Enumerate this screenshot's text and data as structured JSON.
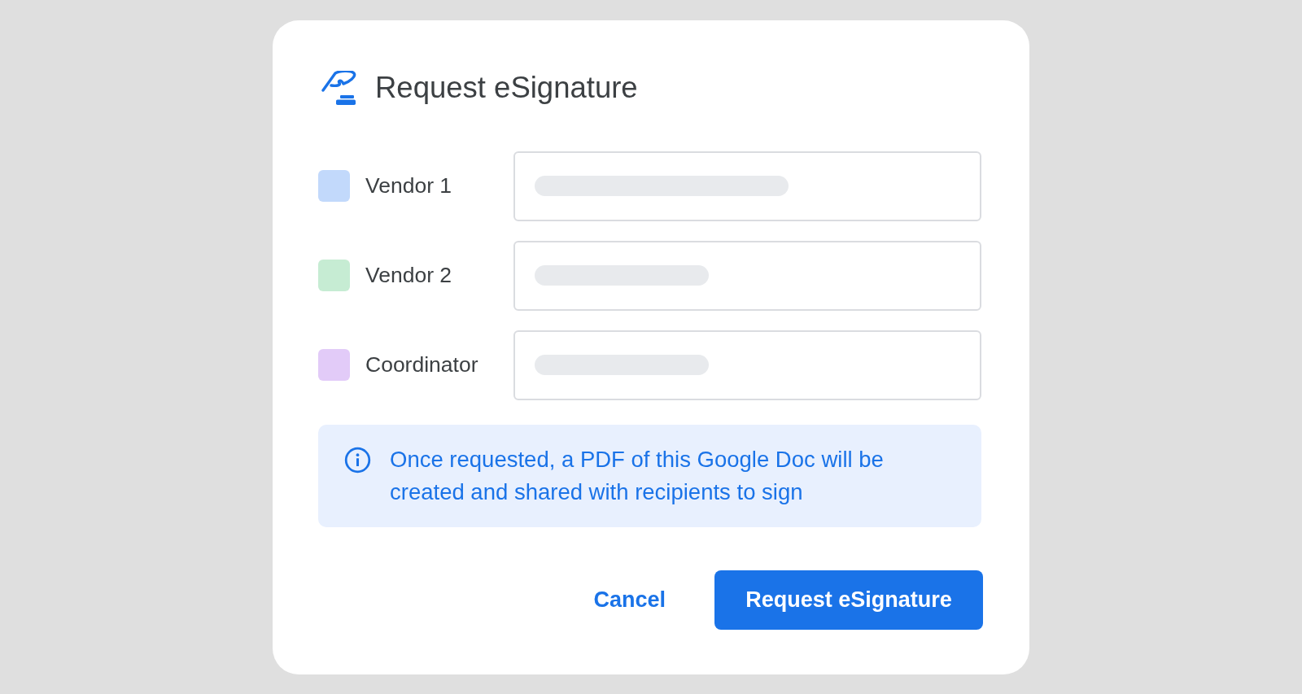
{
  "dialog": {
    "title": "Request eSignature"
  },
  "signers": [
    {
      "label": "Vendor 1",
      "color": "#c2d9fb",
      "field": {
        "kind": "wide"
      }
    },
    {
      "label": "Vendor 2",
      "color": "#c6ecd3",
      "field": {
        "kind": "narrow"
      }
    },
    {
      "label": "Coordinator",
      "color": "#e2cbf8",
      "field": {
        "kind": "narrow"
      }
    }
  ],
  "notice": {
    "text": "Once requested, a PDF of this Google Doc will be created and shared with recipients to sign"
  },
  "buttons": [
    {
      "label": "Cancel",
      "kind": "text"
    },
    {
      "label": "Request eSignature",
      "kind": "filled"
    }
  ]
}
